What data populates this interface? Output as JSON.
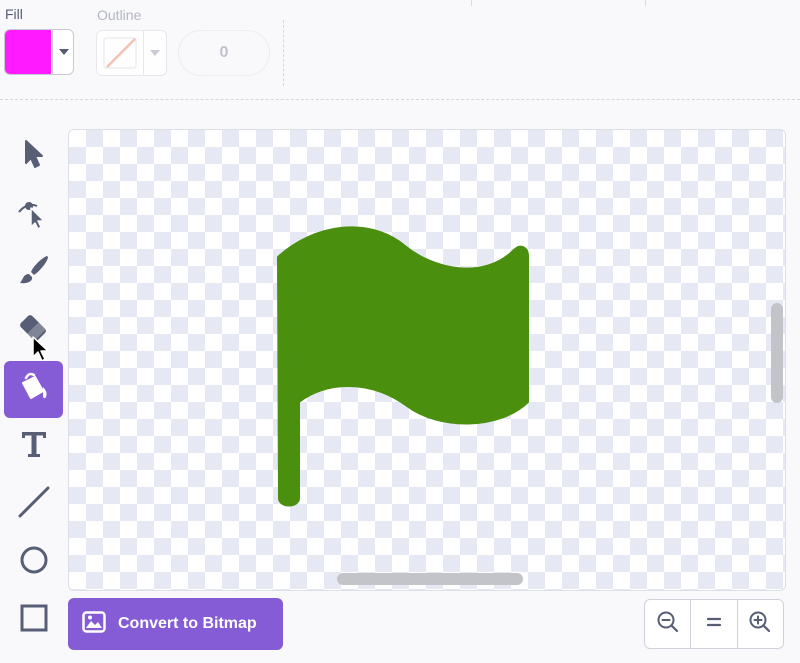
{
  "toolbar": {
    "fill_label": "Fill",
    "fill_color": "#ff1aff",
    "outline_label": "Outline",
    "outline_width": "0"
  },
  "tools": [
    {
      "name": "select-tool",
      "icon": "arrow-pointer-icon"
    },
    {
      "name": "reshape-tool",
      "icon": "reshape-pointer-icon"
    },
    {
      "name": "brush-tool",
      "icon": "paintbrush-icon"
    },
    {
      "name": "eraser-tool",
      "icon": "eraser-icon"
    },
    {
      "name": "fill-tool",
      "icon": "paint-bucket-icon",
      "active": true
    },
    {
      "name": "text-tool",
      "icon": "text-t-icon"
    },
    {
      "name": "line-tool",
      "icon": "line-icon"
    },
    {
      "name": "circle-tool",
      "icon": "circle-icon"
    },
    {
      "name": "rectangle-tool",
      "icon": "rectangle-icon"
    }
  ],
  "canvas": {
    "flag_color": "#4a8f0e"
  },
  "bottom": {
    "convert_label": "Convert to Bitmap",
    "zoom_out_icon": "zoom-out-icon",
    "zoom_reset_icon": "equals-icon",
    "zoom_in_icon": "zoom-in-icon"
  },
  "colors": {
    "accent": "#855cd6",
    "icon": "#575e75"
  }
}
